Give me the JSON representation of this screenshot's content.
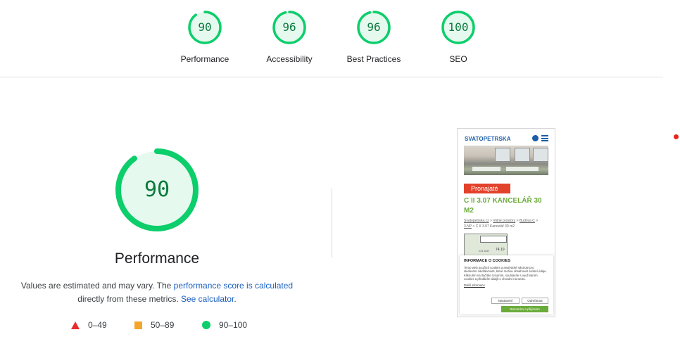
{
  "categories": [
    {
      "score": "90",
      "fraction": 0.9,
      "label": "Performance"
    },
    {
      "score": "96",
      "fraction": 0.96,
      "label": "Accessibility"
    },
    {
      "score": "96",
      "fraction": 0.96,
      "label": "Best Practices"
    },
    {
      "score": "100",
      "fraction": 1.0,
      "label": "SEO"
    }
  ],
  "colors": {
    "pass": "#0cce6b",
    "pass_text": "#0c7a3d",
    "pass_bg": "#e6f9ef",
    "average": "#f4a62a",
    "fail": "#eb2a2a",
    "link": "#1a5fc0"
  },
  "performance": {
    "score": "90",
    "fraction": 0.9,
    "title": "Performance",
    "desc_part1": "Values are estimated and may vary. The ",
    "desc_link1": "performance score is calculated",
    "desc_part2": " directly from these metrics. ",
    "desc_link2": "See calculator",
    "desc_part3": "."
  },
  "legend": [
    {
      "shape": "triangle-icon",
      "range": "0–49"
    },
    {
      "shape": "square-icon",
      "range": "50–89"
    },
    {
      "shape": "circle-icon",
      "range": "90–100"
    }
  ],
  "preview": {
    "logo": "SVATOPETRSKA",
    "badge": "Pronajaté",
    "title": "C II 3.07 KANCELÁŘ 30 M2",
    "crumb_link1": "Svatopetrska.cz",
    "crumb_link2": "Volné prostory",
    "crumb_link3": "Budova C",
    "crumb_link4": "3.NP",
    "crumb_current": "C II 3.07 Kancelář 30 m2",
    "plan_label": "C II 3.07",
    "plan_size": "74.10",
    "cookie_title": "INFORMACE O COOKIES",
    "cookie_text": "Tento web používá cookies a analytické nástroje pro sledování návštěvnosti, které mohou obsahovat osobní údaje. Kliknutím na tlačítko rozumím, souhlasíte s využíváním cookies a předáním údajů o chování na webu.",
    "cookie_more": "Další informace",
    "btn_settings": "Nastavení",
    "btn_decline": "Odmítnout",
    "btn_accept": "Rozumím a přijímám"
  }
}
